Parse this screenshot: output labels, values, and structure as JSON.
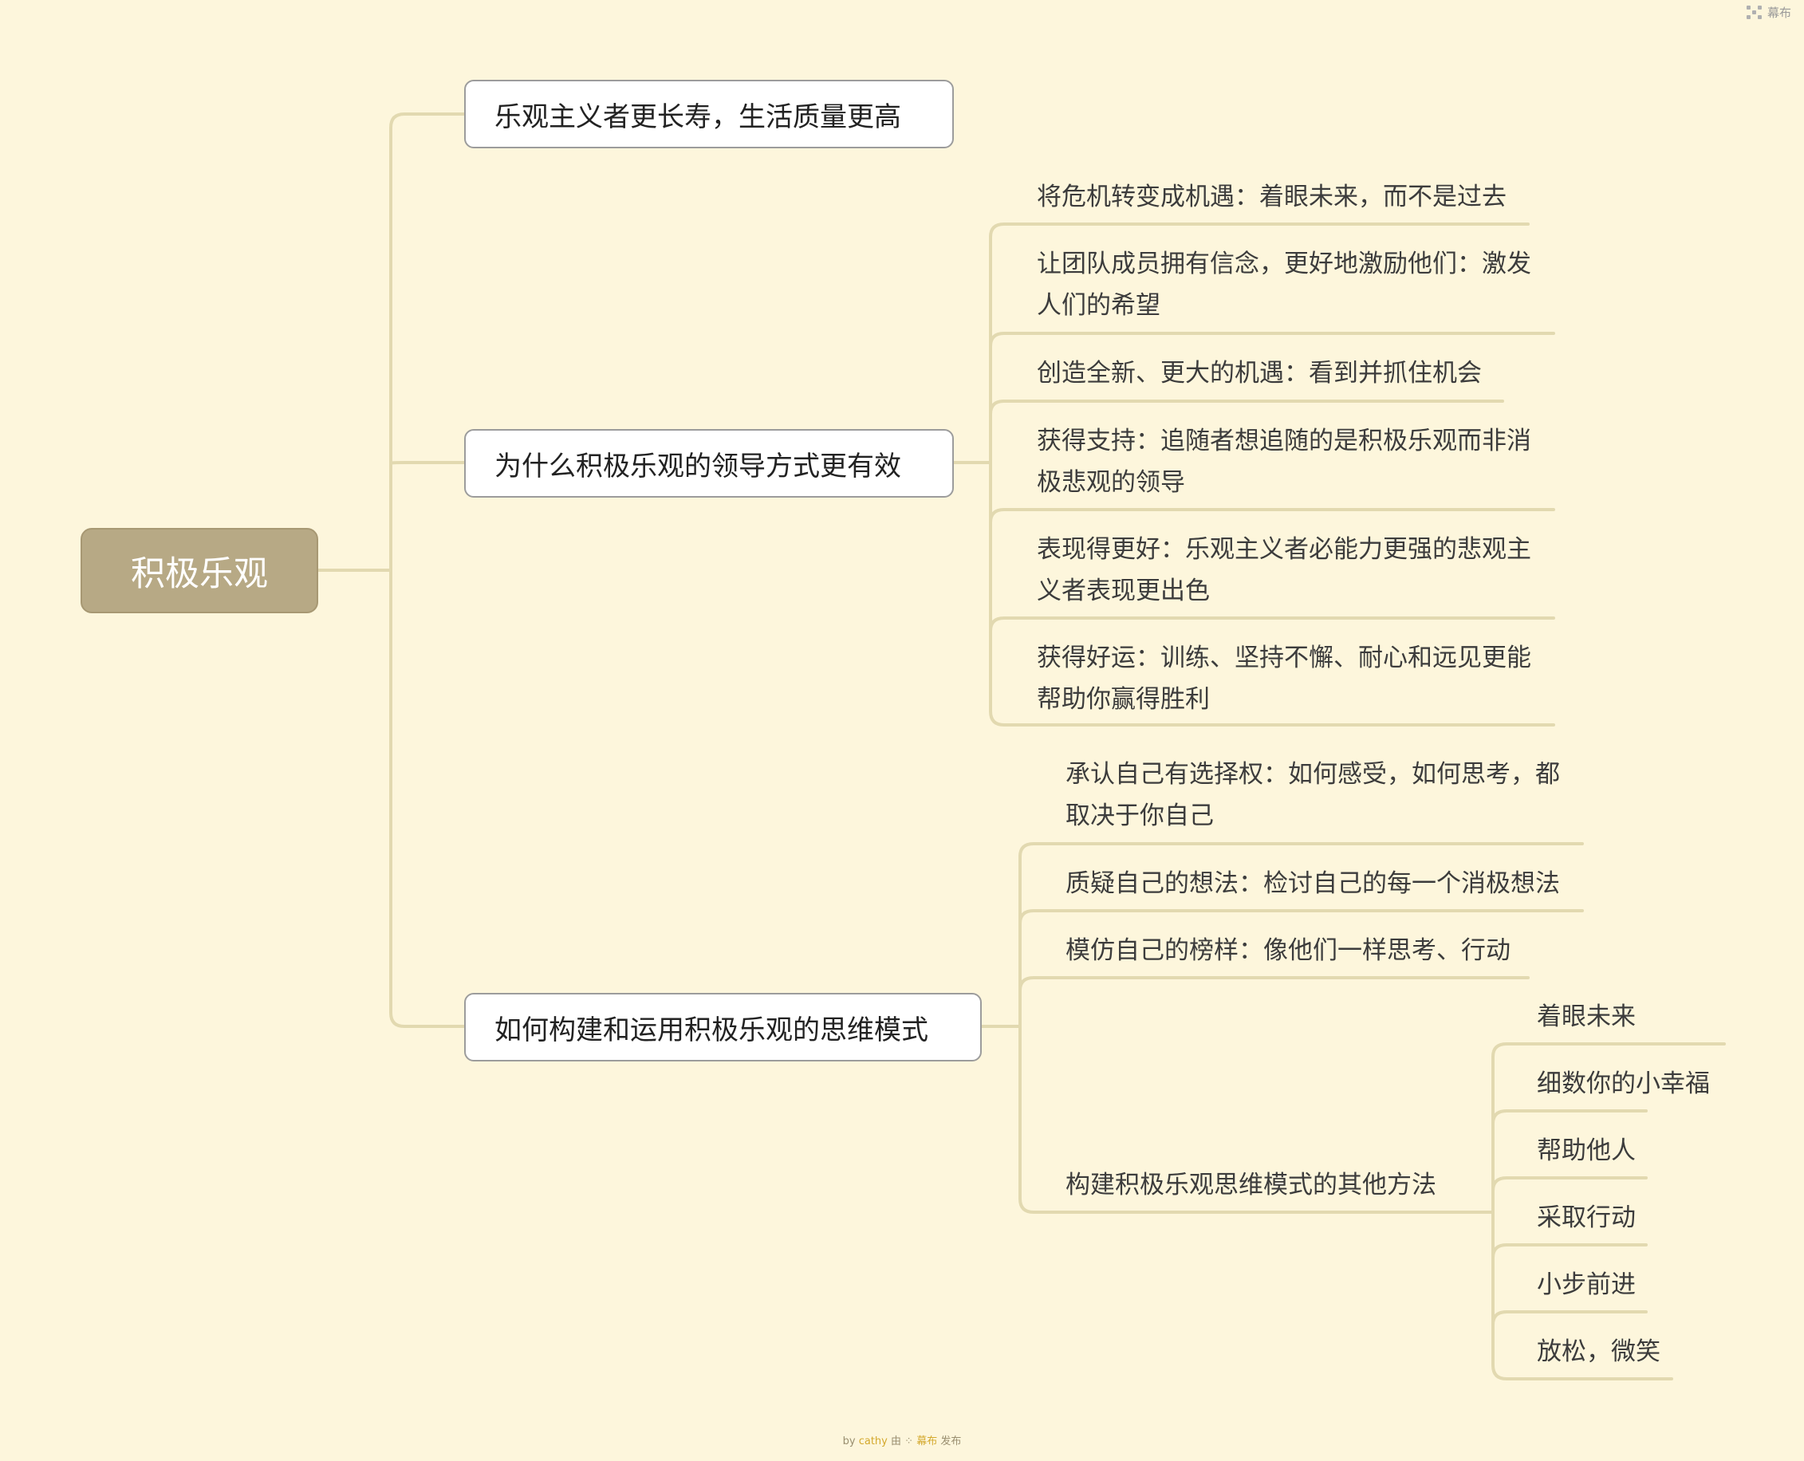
{
  "watermark": {
    "brand_label": "幕布"
  },
  "mindmap": {
    "root": "积极乐观",
    "branches": [
      {
        "label": "乐观主义者更长寿，生活质量更高"
      },
      {
        "label": "为什么积极乐观的领导方式更有效",
        "children": [
          "将危机转变成机遇：着眼未来，而不是过去",
          "让团队成员拥有信念，更好地激励他们：激发人们的希望",
          "创造全新、更大的机遇：看到并抓住机会",
          "获得支持：追随者想追随的是积极乐观而非消极悲观的领导",
          "表现得更好：乐观主义者必能力更强的悲观主义者表现更出色",
          "获得好运：训练、坚持不懈、耐心和远见更能帮助你赢得胜利"
        ]
      },
      {
        "label": "如何构建和运用积极乐观的思维模式",
        "children": [
          "承认自己有选择权：如何感受，如何思考，都取决于你自己",
          "质疑自己的想法：检讨自己的每一个消极想法",
          "模仿自己的榜样：像他们一样思考、行动",
          {
            "label": "构建积极乐观思维模式的其他方法",
            "children": [
              "着眼未来",
              "细数你的小幸福",
              "帮助他人",
              "采取行动",
              "小步前进",
              "放松，微笑"
            ]
          }
        ]
      }
    ]
  },
  "footer": {
    "by": "by",
    "author": "cathy",
    "middle": "由",
    "brand": "幕布",
    "suffix": "发布"
  }
}
